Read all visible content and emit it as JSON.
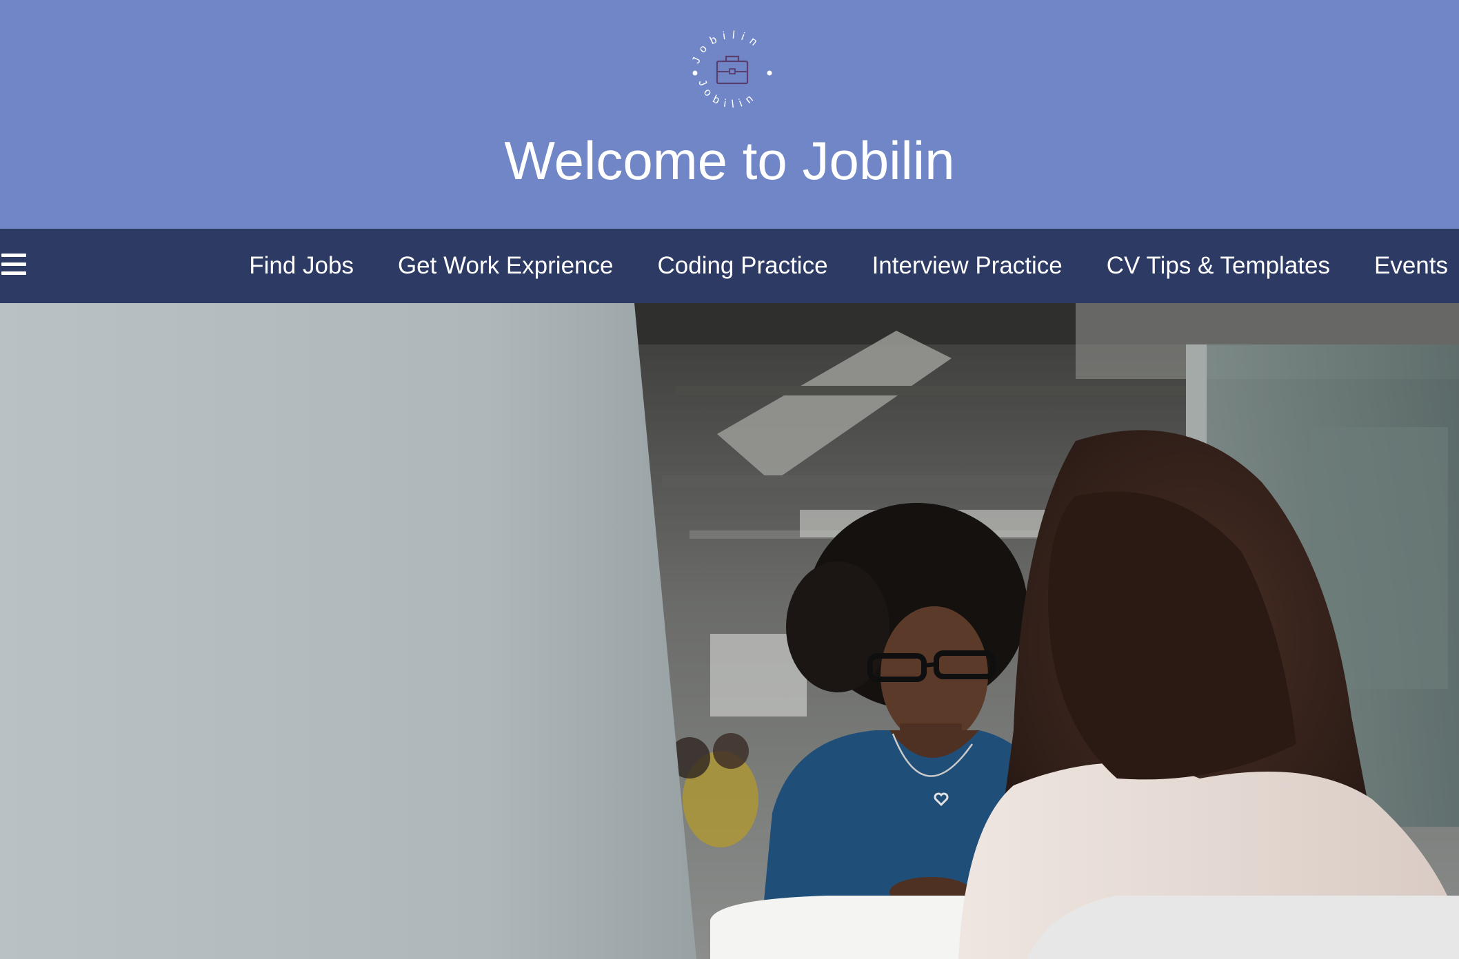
{
  "header": {
    "logo_text": "Jobilin",
    "title": "Welcome to Jobilin",
    "background_color": "#7086c6"
  },
  "nav": {
    "background_color": "#2d3a63",
    "menu_icon": "hamburger-menu-icon",
    "items": [
      {
        "label": "Find Jobs"
      },
      {
        "label": "Get Work Exprience"
      },
      {
        "label": "Coding Practice"
      },
      {
        "label": "Interview Practice"
      },
      {
        "label": "CV Tips & Templates"
      },
      {
        "label": "Events"
      }
    ]
  },
  "hero": {
    "image": "interview-photo"
  }
}
